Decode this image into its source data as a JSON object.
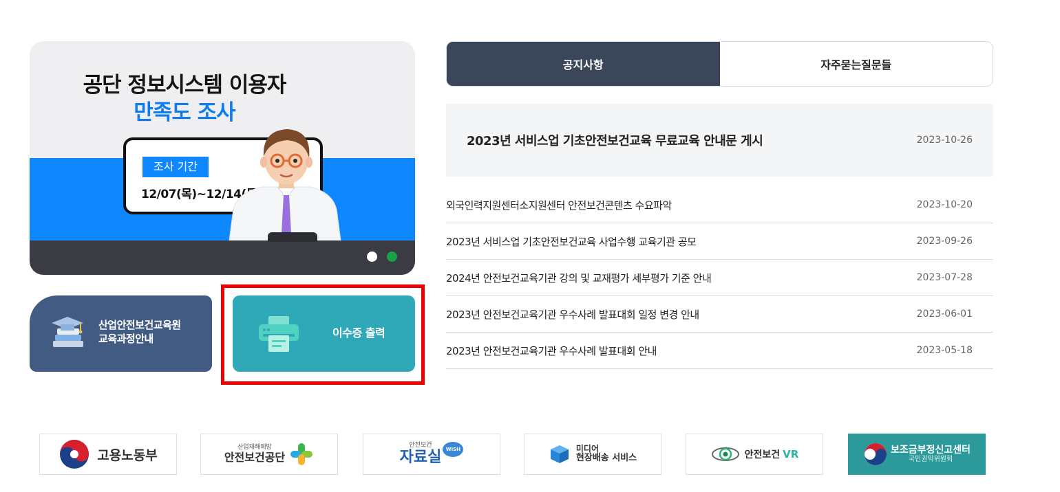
{
  "banner": {
    "title_line1": "공단 정보시스템 이용자",
    "title_line2": "만족도 조사",
    "period_tag": "조사 기간",
    "period_dates": "12/07(목)~12/14(목)",
    "slide_count": 2,
    "active_slide": 2
  },
  "quick_links": {
    "course_label_line1": "산업안전보건교육원",
    "course_label_line2": "교육과정안내",
    "print_label": "이수증 출력"
  },
  "tabs": [
    {
      "label": "공지사항",
      "active": true
    },
    {
      "label": "자주묻는질문들",
      "active": false
    }
  ],
  "featured_notice": {
    "title": "2023년 서비스업 기초안전보건교육 무료교육 안내문 게시",
    "date": "2023-10-26"
  },
  "notices": [
    {
      "title": "외국인력지원센터소지원센터 안전보건콘텐츠 수요파악",
      "date": "2023-10-20"
    },
    {
      "title": "2023년 서비스업 기초안전보건교육 사업수행 교육기관 공모",
      "date": "2023-09-26"
    },
    {
      "title": "2024년 안전보건교육기관 강의 및 교재평가 세부평가 기준 안내",
      "date": "2023-07-28"
    },
    {
      "title": "2023년 안전보건교육기관 우수사례 발표대회 일정 변경 안내",
      "date": "2023-06-01"
    },
    {
      "title": "2023년 안전보건교육기관 우수사례 발표대회 안내",
      "date": "2023-05-18"
    }
  ],
  "partner_logos": {
    "moel": "고용노동부",
    "kosha_small": "산업재해예방",
    "kosha": "안전보건공단",
    "archive_small": "안전보건",
    "archive": "자료실",
    "archive_badge": "WISH",
    "media_line1": "미디어",
    "media_line2": "현장배송 서비스",
    "vr_prefix": "안전보건",
    "vr_suffix": "VR",
    "subsidy_line1": "보조금부정신고센터",
    "subsidy_line2": "국민권익위원회"
  },
  "colors": {
    "tab_active": "#3b465a",
    "banner_blue": "#0f88ff",
    "course_button": "#425b82",
    "print_button": "#2fa9b8",
    "highlight": "#ee0000"
  }
}
